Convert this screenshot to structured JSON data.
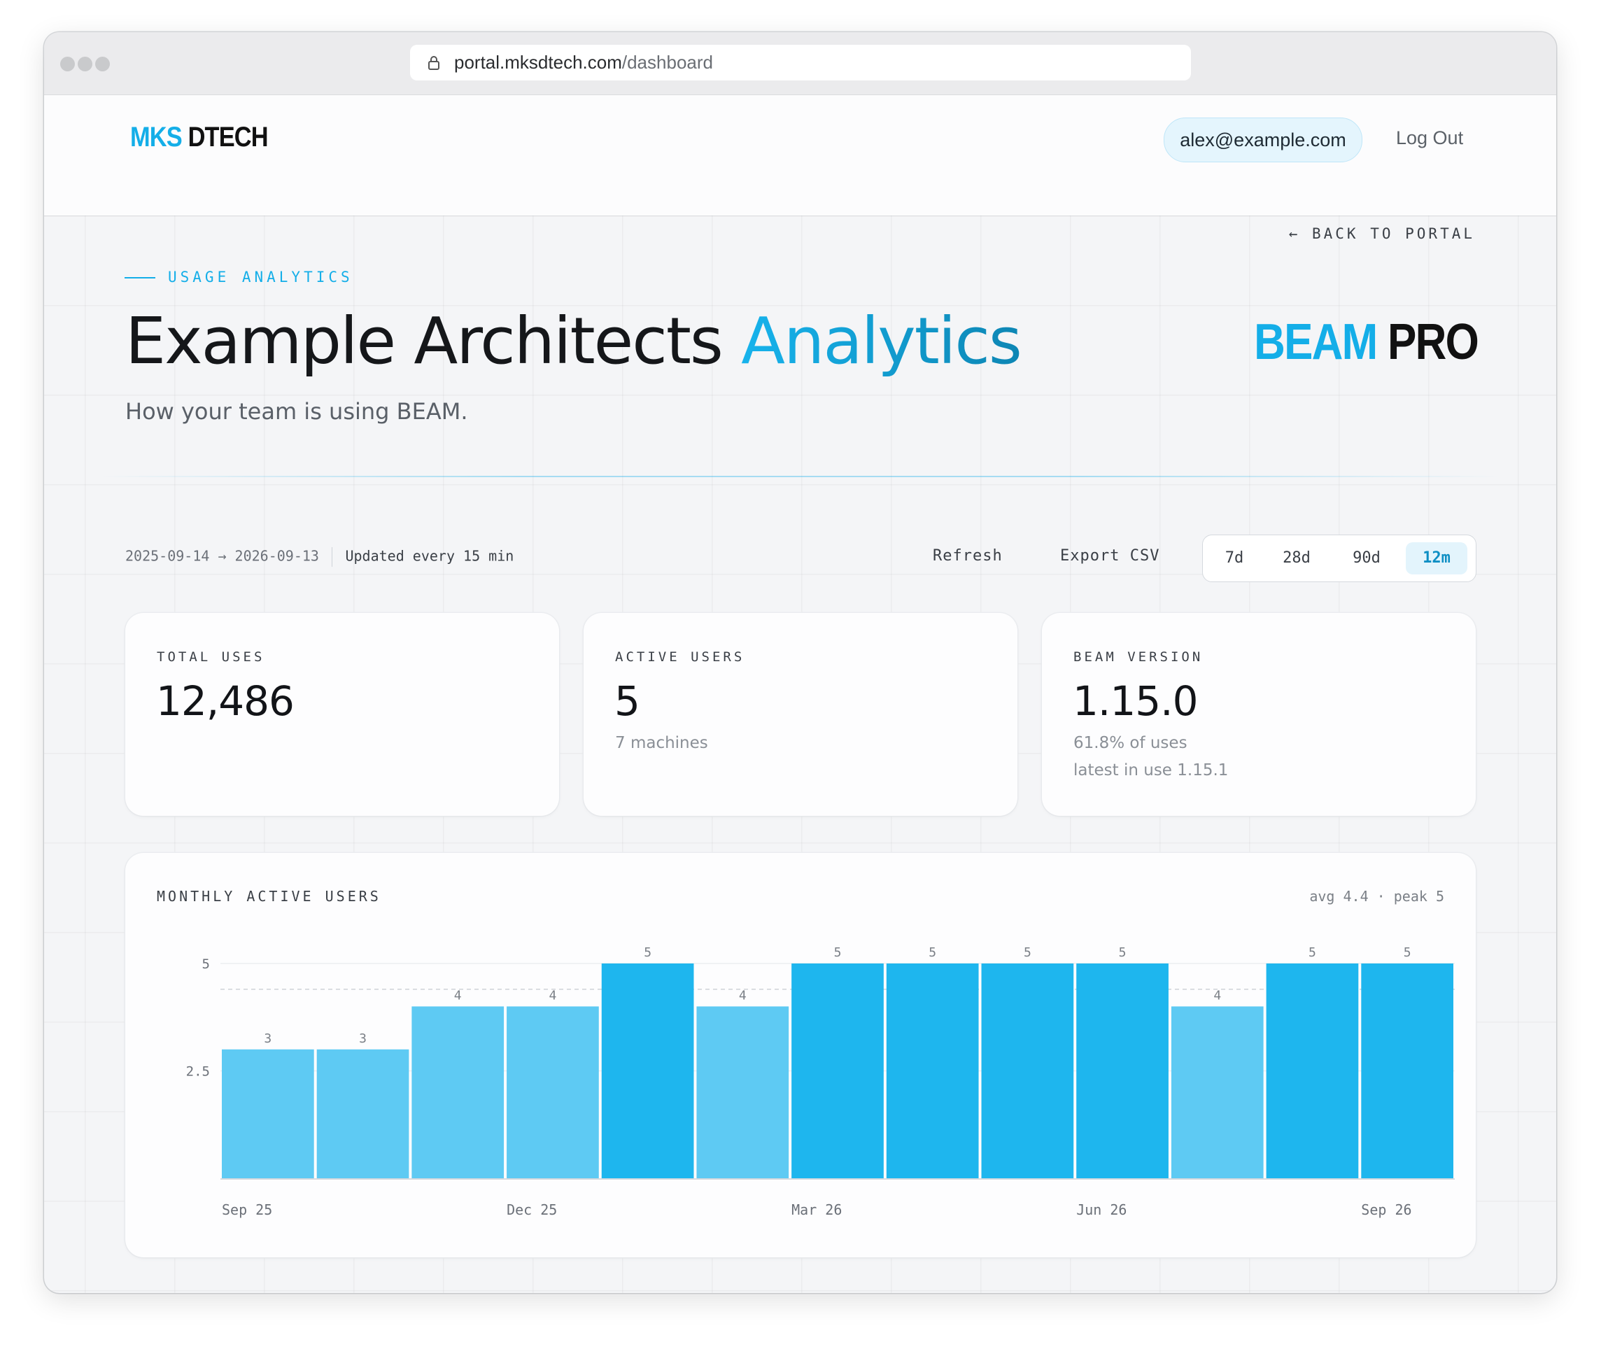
{
  "browser": {
    "url_host": "portal.mksdtech.com",
    "url_path": "/dashboard"
  },
  "nav": {
    "logo_part1": "MKS",
    "logo_part2": " DTECH",
    "email": "alex@example.com",
    "logout_label": "Log Out"
  },
  "header": {
    "back_label": "← BACK TO PORTAL",
    "eyebrow": "USAGE ANALYTICS",
    "title_main": "Example Architects ",
    "title_accent": "Analytics",
    "subtitle": "How your team is using BEAM.",
    "brand_part1": "BEAM",
    "brand_part2": " PRO"
  },
  "toolbar": {
    "date_range": "2025-09-14 → 2026-09-13",
    "update_note": "Updated every 15 min",
    "refresh_label": "Refresh",
    "export_label": "Export CSV",
    "ranges": [
      "7d",
      "28d",
      "90d",
      "12m"
    ],
    "active_range": "12m"
  },
  "stats": [
    {
      "label": "TOTAL USES",
      "value": "12,486",
      "notes": []
    },
    {
      "label": "ACTIVE USERS",
      "value": "5",
      "notes": [
        "7 machines"
      ]
    },
    {
      "label": "BEAM VERSION",
      "value": "1.15.0",
      "notes": [
        "61.8% of uses",
        "latest in use 1.15.1"
      ]
    }
  ],
  "colors": {
    "accent": "#14aee8",
    "bar_peak": "#1eb6ee",
    "bar_normal": "#5ecaf3"
  },
  "chart_data": {
    "type": "bar",
    "title": "MONTHLY ACTIVE USERS",
    "stats_label": "avg 4.4 · peak 5",
    "values": [
      3,
      3,
      4,
      4,
      5,
      4,
      5,
      5,
      5,
      5,
      4,
      5,
      5
    ],
    "x_tick_labels": [
      "Sep 25",
      "Dec 25",
      "Mar 26",
      "Jun 26",
      "Sep 26"
    ],
    "x_tick_bar_index": [
      0,
      3,
      6,
      9,
      12
    ],
    "y_ticks": [
      "2.5",
      "5"
    ],
    "ylim": [
      0,
      5
    ],
    "avg": 4.4,
    "peak": 5,
    "grid": true
  }
}
